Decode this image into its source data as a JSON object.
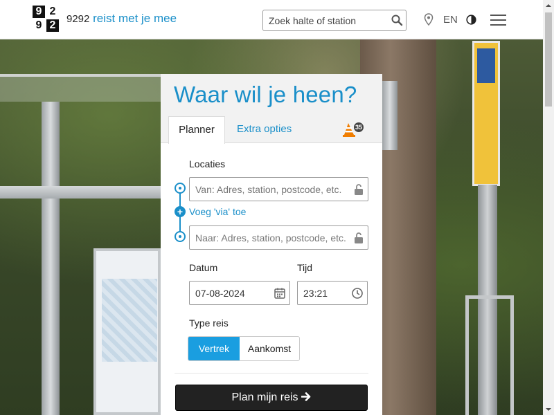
{
  "header": {
    "logo_digits": [
      "9",
      "2",
      "9",
      "2"
    ],
    "brand_number": "9292",
    "brand_slogan": "reist met je mee",
    "search_placeholder": "Zoek halte of station",
    "language": "EN"
  },
  "planner": {
    "title": "Waar wil je heen?",
    "tabs": {
      "planner": "Planner",
      "extra": "Extra opties"
    },
    "disruption_count": "35",
    "locations_label": "Locaties",
    "from_placeholder": "Van: Adres, station, postcode, etc.",
    "to_placeholder": "Naar: Adres, station, postcode, etc.",
    "via_label": "Voeg 'via' toe",
    "date_label": "Datum",
    "date_value": "07-08-2024",
    "time_label": "Tijd",
    "time_value": "23:21",
    "trip_type_label": "Type reis",
    "trip_type_options": [
      "Vertrek",
      "Aankomst"
    ],
    "trip_type_selected": "Vertrek",
    "submit_label": "Plan mijn reis"
  },
  "colors": {
    "accent": "#1a8fc9",
    "toggle_active": "#1a9ee0",
    "button_dark": "#222222",
    "warning_orange": "#f07d00"
  }
}
